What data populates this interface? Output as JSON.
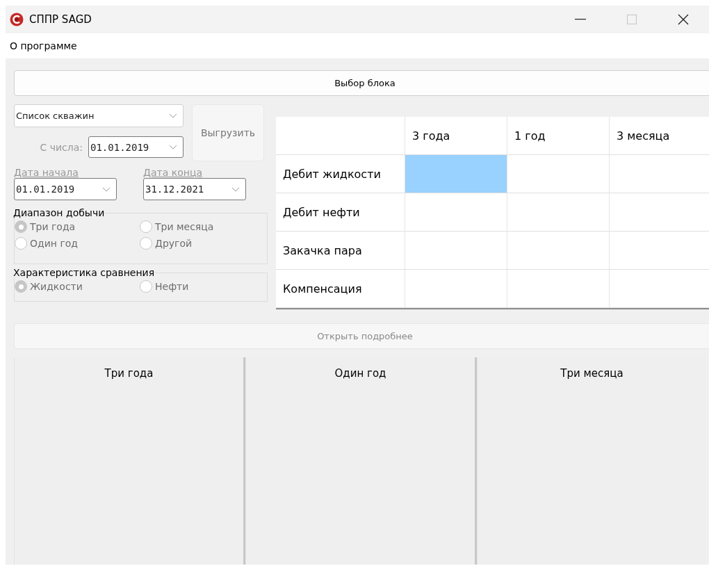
{
  "window": {
    "title": "СППР SAGD",
    "maximize_disabled": true
  },
  "menu": [
    "О программе"
  ],
  "block_button": {
    "label": "Выбор блока",
    "disabled": false
  },
  "well_list": {
    "value": "Список скважин",
    "disabled": false
  },
  "export_button": {
    "label": "Выгрузить",
    "disabled": true
  },
  "from_date": {
    "label": "С числа:",
    "value": "01.01.2019",
    "disabled": true
  },
  "start_date": {
    "label": "Дата начала",
    "value": "01.01.2019",
    "disabled": true
  },
  "end_date": {
    "label": "Дата конца",
    "value": "31.12.2021",
    "disabled": true
  },
  "range_group": {
    "title": "Диапазон добычи",
    "options": [
      {
        "label": "Три года",
        "selected": true,
        "disabled": true
      },
      {
        "label": "Три месяца",
        "selected": false,
        "disabled": true
      },
      {
        "label": "Один год",
        "selected": false,
        "disabled": true
      },
      {
        "label": "Другой",
        "selected": false,
        "disabled": true
      }
    ]
  },
  "compare_group": {
    "title": "Характеристика сравнения",
    "options": [
      {
        "label": "Жидкости",
        "selected": true,
        "disabled": true
      },
      {
        "label": "Нефти",
        "selected": false,
        "disabled": true
      }
    ]
  },
  "table": {
    "columns": [
      "3 года",
      "1 год",
      "3 месяца"
    ],
    "rows": [
      {
        "label": "Дебит жидкости",
        "cells": [
          {
            "selected": true
          },
          {
            "selected": false
          },
          {
            "selected": false
          }
        ]
      },
      {
        "label": "Дебит нефти",
        "cells": [
          {
            "selected": false
          },
          {
            "selected": false
          },
          {
            "selected": false
          }
        ]
      },
      {
        "label": "Закачка пара",
        "cells": [
          {
            "selected": false
          },
          {
            "selected": false
          },
          {
            "selected": false
          }
        ]
      },
      {
        "label": "Компенсация",
        "cells": [
          {
            "selected": false
          },
          {
            "selected": false
          },
          {
            "selected": false
          }
        ]
      }
    ]
  },
  "details_button": {
    "label": "Открыть подробнее",
    "disabled": true
  },
  "panels": [
    {
      "title": "Три года"
    },
    {
      "title": "Один год"
    },
    {
      "title": "Три месяца"
    }
  ]
}
